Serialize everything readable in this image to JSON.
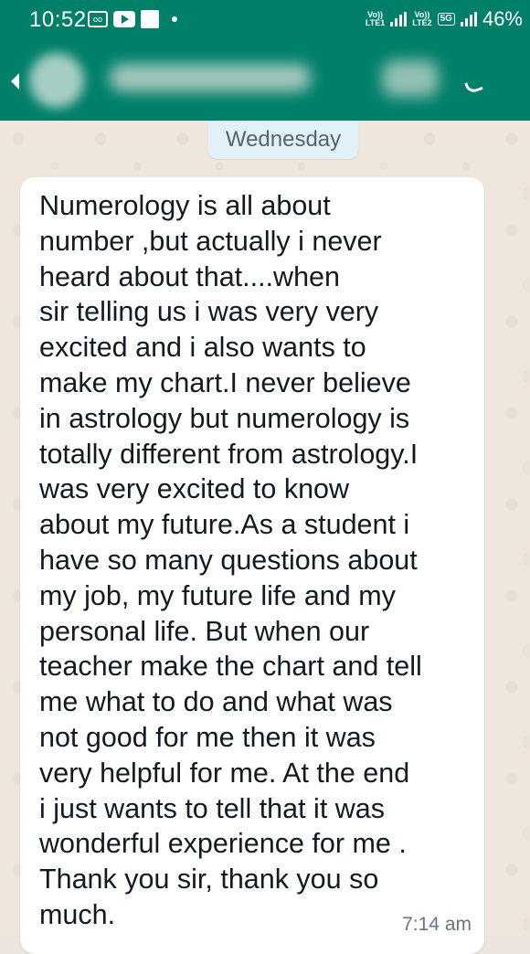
{
  "status_bar": {
    "time": "10:52",
    "lte1_top": "Vo))",
    "lte1_bottom": "LTE1",
    "lte2_top": "Vo))",
    "lte2_bottom": "LTE2",
    "network_type": "5G",
    "battery": "46%",
    "icons": [
      "caption-icon",
      "youtube-icon",
      "message-icon",
      "notification-dot-icon",
      "signal-icon",
      "battery-icon"
    ]
  },
  "chat_header": {
    "contact_name": "",
    "icons": [
      "back-arrow-icon",
      "avatar",
      "call-icon"
    ]
  },
  "date_separator": "Wednesday",
  "message": {
    "text": "Numerology is all about\nnumber ,but actually i never\nheard about that....when\nsir telling us i was very very\nexcited and i also wants to\nmake my chart.I never believe\nin astrology but numerology is\ntotally different from astrology.I\nwas very excited to know\nabout my future.As a student i\nhave so many questions about\nmy job, my future life and my\npersonal life. But when our\nteacher make the chart and tell\nme what to do and what was\nnot good for me then it was\nvery helpful for me. At the end\ni just wants to tell that it was\nwonderful experience for me .\nThank you sir, thank you so\nmuch.",
    "time": "7:14 am"
  },
  "colors": {
    "header": "#008069",
    "bubble": "#ffffff",
    "wallpaper": "#efe7dd",
    "date_chip": "#e1f1f7"
  }
}
